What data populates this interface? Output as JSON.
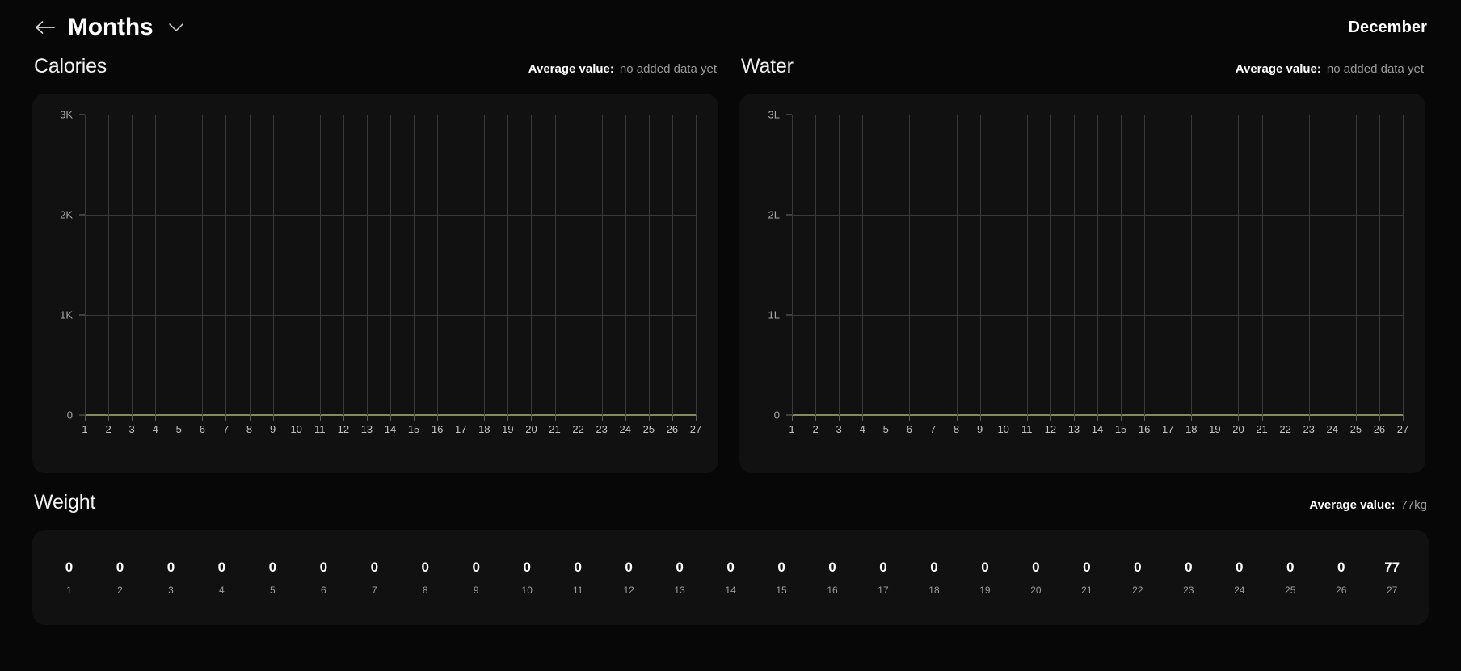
{
  "header": {
    "back_icon": "arrow-left-icon",
    "title": "Months",
    "dropdown_icon": "chevron-down-icon",
    "month": "December"
  },
  "sections": {
    "calories": {
      "title": "Calories",
      "avg_label": "Average value:",
      "avg_value": "no added data yet"
    },
    "water": {
      "title": "Water",
      "avg_label": "Average value:",
      "avg_value": "no added data yet"
    },
    "weight": {
      "title": "Weight",
      "avg_label": "Average value:",
      "avg_value": "77kg"
    }
  },
  "colors": {
    "page_bg": "#070707",
    "card_bg": "#111111",
    "grid": "#3a3a3a",
    "baseline": "#858b56",
    "text_primary": "#ffffff",
    "text_muted": "#9b9b9b"
  },
  "chart_data": [
    {
      "type": "line",
      "title": "Calories",
      "xlabel": "",
      "ylabel": "",
      "categories": [
        1,
        2,
        3,
        4,
        5,
        6,
        7,
        8,
        9,
        10,
        11,
        12,
        13,
        14,
        15,
        16,
        17,
        18,
        19,
        20,
        21,
        22,
        23,
        24,
        25,
        26,
        27
      ],
      "values": [
        0,
        0,
        0,
        0,
        0,
        0,
        0,
        0,
        0,
        0,
        0,
        0,
        0,
        0,
        0,
        0,
        0,
        0,
        0,
        0,
        0,
        0,
        0,
        0,
        0,
        0,
        0
      ],
      "ytick_labels": [
        "3K",
        "2K",
        "1K",
        "0"
      ],
      "ytick_values": [
        3000,
        2000,
        1000,
        0
      ],
      "ylim": [
        0,
        3000
      ],
      "grid": true,
      "legend": "none",
      "annotation": "no added data yet"
    },
    {
      "type": "line",
      "title": "Water",
      "xlabel": "",
      "ylabel": "",
      "categories": [
        1,
        2,
        3,
        4,
        5,
        6,
        7,
        8,
        9,
        10,
        11,
        12,
        13,
        14,
        15,
        16,
        17,
        18,
        19,
        20,
        21,
        22,
        23,
        24,
        25,
        26,
        27
      ],
      "values": [
        0,
        0,
        0,
        0,
        0,
        0,
        0,
        0,
        0,
        0,
        0,
        0,
        0,
        0,
        0,
        0,
        0,
        0,
        0,
        0,
        0,
        0,
        0,
        0,
        0,
        0,
        0
      ],
      "ytick_labels": [
        "3L",
        "2L",
        "1L",
        "0"
      ],
      "ytick_values": [
        3,
        2,
        1,
        0
      ],
      "ylim": [
        0,
        3
      ],
      "grid": true,
      "legend": "none",
      "annotation": "no added data yet"
    },
    {
      "type": "table",
      "title": "Weight",
      "categories": [
        1,
        2,
        3,
        4,
        5,
        6,
        7,
        8,
        9,
        10,
        11,
        12,
        13,
        14,
        15,
        16,
        17,
        18,
        19,
        20,
        21,
        22,
        23,
        24,
        25,
        26,
        27
      ],
      "values": [
        0,
        0,
        0,
        0,
        0,
        0,
        0,
        0,
        0,
        0,
        0,
        0,
        0,
        0,
        0,
        0,
        0,
        0,
        0,
        0,
        0,
        0,
        0,
        0,
        0,
        0,
        77
      ],
      "unit": "kg",
      "average": 77
    }
  ]
}
